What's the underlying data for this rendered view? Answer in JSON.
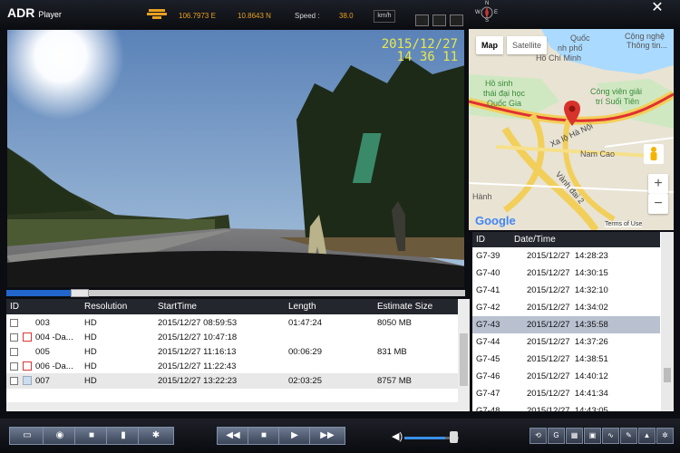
{
  "app": {
    "title_main": "ADR",
    "title_sub": "Player"
  },
  "gps": {
    "longitude": "106.7973 E",
    "latitude": "10.8643 N",
    "speed_label": "Speed :",
    "speed_value": "38.0",
    "speed_unit": "km/h"
  },
  "compass": {
    "n": "N",
    "s": "S",
    "e": "E",
    "w": "W"
  },
  "video": {
    "date": "2015/12/27",
    "time": "14 36 11"
  },
  "map": {
    "type_map": "Map",
    "type_satellite": "Satellite",
    "labels": [
      "Quốc",
      "nh phố",
      "Hồ Chí Minh",
      "Cộng nghệ",
      "Thông tin...",
      "Hồ sinh",
      "thái đại học",
      "Quốc Gia",
      "Công viên giải",
      "trí Suối Tiên",
      "Xa lộ Hà Nội",
      "Nam Cao",
      "Vành đai 2",
      "Hành"
    ],
    "zoom_in": "+",
    "zoom_out": "−",
    "logo": "Google",
    "terms": "Terms of Use"
  },
  "clip_list": {
    "headers": [
      "ID",
      "Date/Time"
    ],
    "rows": [
      [
        "G7-39",
        "2015/12/27  14:28:23"
      ],
      [
        "G7-40",
        "2015/12/27  14:30:15"
      ],
      [
        "G7-41",
        "2015/12/27  14:32:10"
      ],
      [
        "G7-42",
        "2015/12/27  14:34:02"
      ],
      [
        "G7-43",
        "2015/12/27  14:35:58"
      ],
      [
        "G7-44",
        "2015/12/27  14:37:26"
      ],
      [
        "G7-45",
        "2015/12/27  14:38:51"
      ],
      [
        "G7-46",
        "2015/12/27  14:40:12"
      ],
      [
        "G7-47",
        "2015/12/27  14:41:34"
      ],
      [
        "G7-48",
        "2015/12/27  14:43:05"
      ]
    ],
    "selected": "G7-43"
  },
  "file_list": {
    "headers": [
      "ID",
      "Resolution",
      "StartTime",
      "Length",
      "Estimate Size"
    ],
    "rows": [
      [
        "003",
        "HD",
        "2015/12/27 08:59:53",
        "01:47:24",
        "8050 MB"
      ],
      [
        "004 -Da...",
        "HD",
        "2015/12/27 10:47:18",
        "",
        ""
      ],
      [
        "005",
        "HD",
        "2015/12/27 11:16:13",
        "00:06:29",
        "831 MB"
      ],
      [
        "006 -Da...",
        "HD",
        "2015/12/27 11:22:43",
        "",
        ""
      ],
      [
        "007",
        "HD",
        "2015/12/27 13:22:23",
        "02:03:25",
        "8757 MB"
      ]
    ]
  },
  "playback": {
    "progress_fraction": 0.14,
    "volume_fraction": 0.75
  },
  "colors": {
    "accent_orange": "#e8a020",
    "title_bg": "#1b1f27",
    "timestamp": "#e8e84c",
    "route": "#e03030"
  }
}
